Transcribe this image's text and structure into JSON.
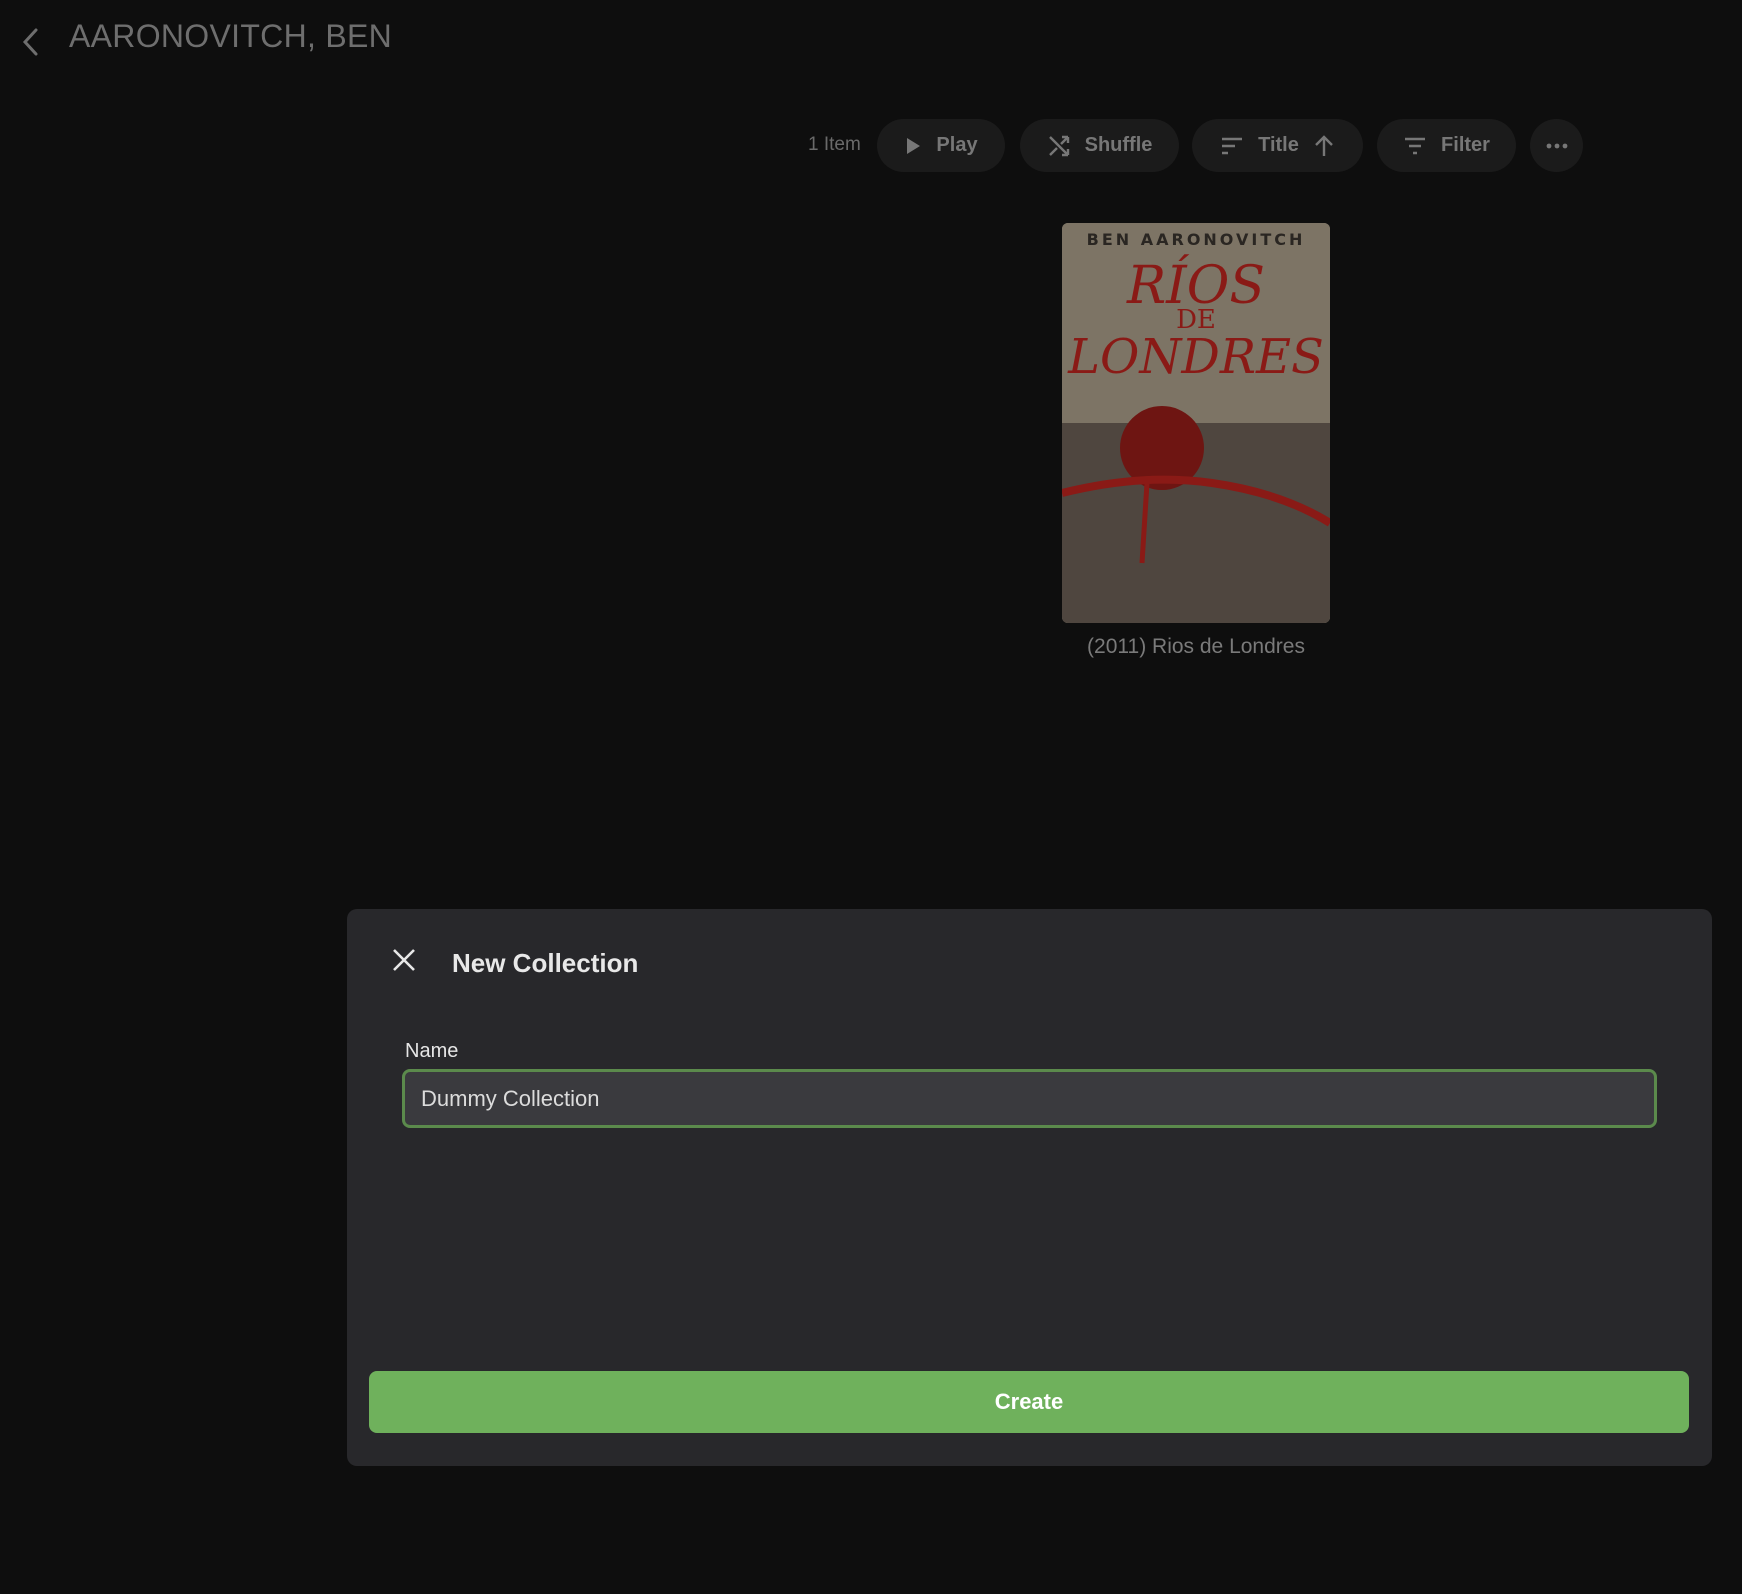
{
  "header": {
    "title": "AARONOVITCH, BEN"
  },
  "toolbar": {
    "count": "1 Item",
    "play": "Play",
    "shuffle": "Shuffle",
    "sort": "Title",
    "filter": "Filter"
  },
  "items": [
    {
      "cover_author": "BEN AARONOVITCH",
      "cover_title": "RÍOS DE LONDRES",
      "caption": "(2011) Rios de Londres"
    }
  ],
  "modal": {
    "title": "New Collection",
    "name_label": "Name",
    "name_value": "Dummy Collection",
    "create": "Create"
  },
  "colors": {
    "accent": "#6fb15c",
    "focus_border": "#5b8a4c"
  }
}
